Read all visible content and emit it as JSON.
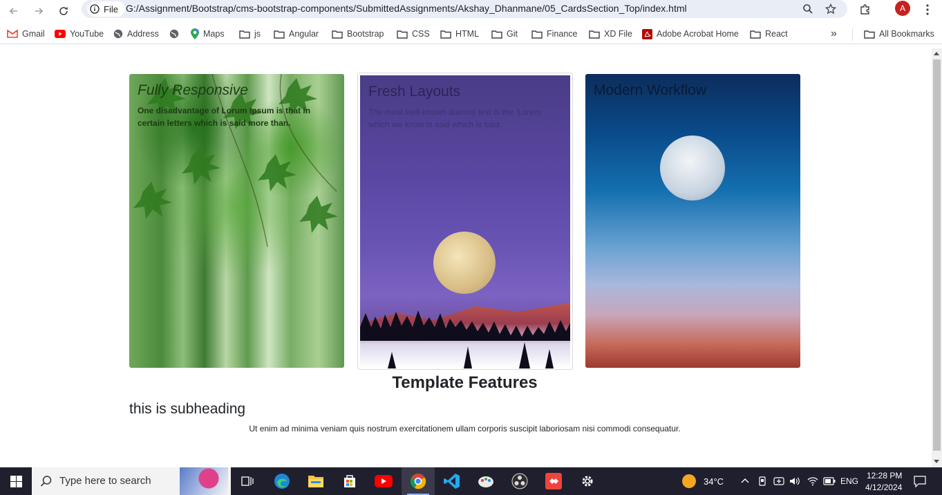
{
  "browser": {
    "file_label": "File",
    "url": "G:/Assignment/Bootstrap/cms-bootstrap-components/SubmittedAssignments/Akshay_Dhanmane/05_CardsSection_Top/index.html",
    "avatar_letter": "A"
  },
  "bookmarks": {
    "items": [
      {
        "label": "Gmail",
        "icon": "gmail-icon"
      },
      {
        "label": "YouTube",
        "icon": "youtube-icon"
      },
      {
        "label": "Address",
        "icon": "globe-icon"
      },
      {
        "label": "",
        "icon": "globe-icon"
      },
      {
        "label": "Maps",
        "icon": "maps-icon"
      },
      {
        "label": "js",
        "icon": "folder-icon"
      },
      {
        "label": "Angular",
        "icon": "folder-icon"
      },
      {
        "label": "Bootstrap",
        "icon": "folder-icon"
      },
      {
        "label": "CSS",
        "icon": "folder-icon"
      },
      {
        "label": "HTML",
        "icon": "folder-icon"
      },
      {
        "label": "Git",
        "icon": "folder-icon"
      },
      {
        "label": "Finance",
        "icon": "folder-icon"
      },
      {
        "label": "XD File",
        "icon": "folder-icon"
      },
      {
        "label": "Adobe Acrobat Home",
        "icon": "acrobat-icon"
      },
      {
        "label": "React",
        "icon": "folder-icon"
      }
    ],
    "overflow": "»",
    "all_bookmarks": "All Bookmarks"
  },
  "cards": [
    {
      "title": "Fully Responsive",
      "text": "One disadvantage of Lorum Ipsum is that in certain letters which is said more than."
    },
    {
      "title": "Fresh Layouts",
      "text": "The most well-known dummy text is the 'Lorem which we know is said which is said."
    },
    {
      "title": "Modern Workflow",
      "text": ""
    }
  ],
  "content": {
    "section_title": "Template Features",
    "subheading": "this is subheading",
    "paragraph": "Ut enim ad minima veniam quis nostrum exercitationem ullam corporis suscipit laboriosam nisi commodi consequatur."
  },
  "taskbar": {
    "search_placeholder": "Type here to search",
    "weather": "34°C",
    "language": "ENG",
    "time": "12:28 PM",
    "date": "4/12/2024"
  }
}
